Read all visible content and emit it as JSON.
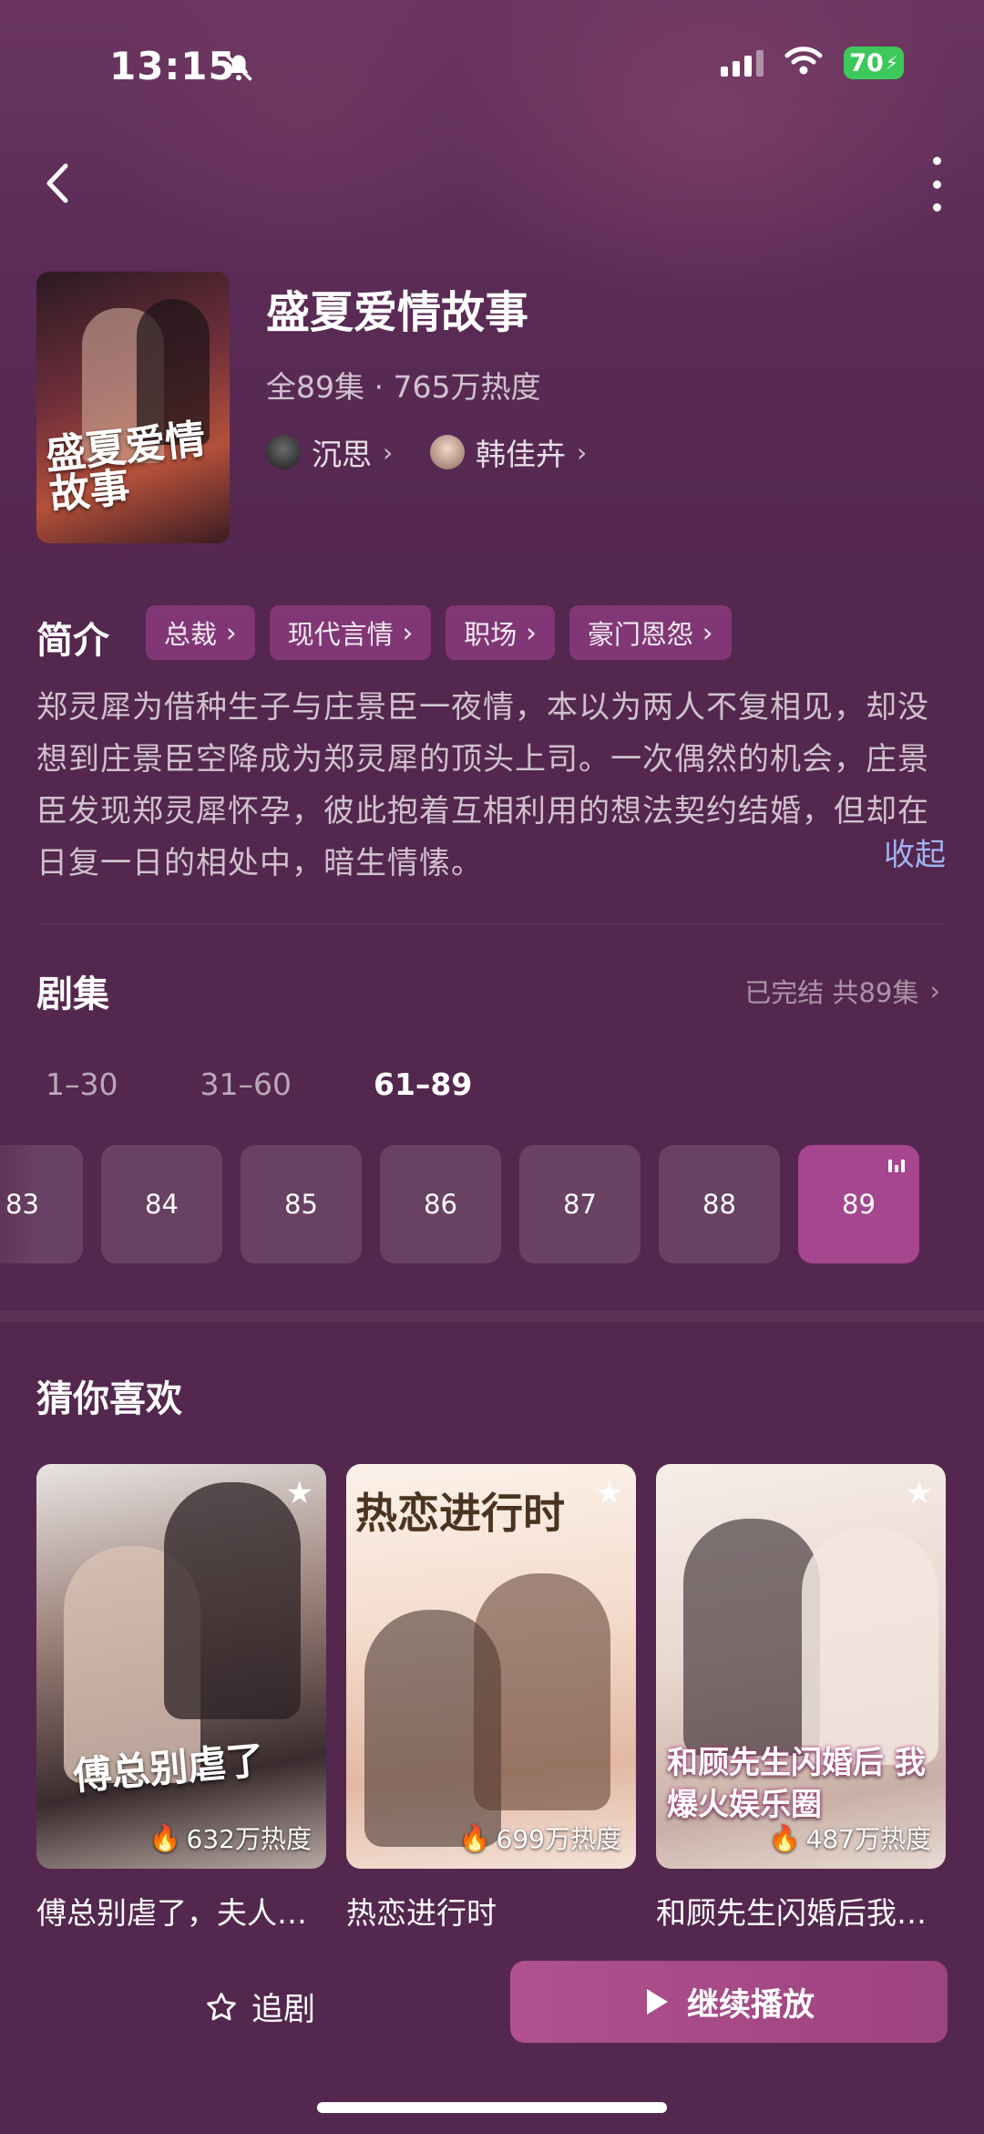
{
  "status_bar": {
    "time": "13:15",
    "battery": "70"
  },
  "drama": {
    "title": "盛夏爱情故事",
    "cover_title": "盛夏爱情故事",
    "meta": "全89集 · 765万热度",
    "cast": [
      {
        "name": "沉思"
      },
      {
        "name": "韩佳卉"
      }
    ]
  },
  "intro": {
    "label": "简介",
    "tags": [
      "总裁",
      "现代言情",
      "职场",
      "豪门恩怨"
    ],
    "description": "郑灵犀为借种生子与庄景臣一夜情，本以为两人不复相见，却没想到庄景臣空降成为郑灵犀的顶头上司。一次偶然的机会，庄景臣发现郑灵犀怀孕，彼此抱着互相利用的想法契约结婚，但却在日复一日的相处中，暗生情愫。",
    "collapse": "收起"
  },
  "episodes": {
    "label": "剧集",
    "status": "已完结 共89集",
    "ranges": [
      "1–30",
      "31–60",
      "61–89"
    ],
    "active_range": "61–89",
    "items": [
      "83",
      "84",
      "85",
      "86",
      "87",
      "88",
      "89"
    ],
    "current": "89"
  },
  "recommend": {
    "label": "猜你喜欢",
    "items": [
      {
        "name": "傅总别虐了，夫人…",
        "heat": "632万热度",
        "poster_text": "傅总别虐了"
      },
      {
        "name": "热恋进行时",
        "heat": "699万热度",
        "poster_text": "热恋进行时"
      },
      {
        "name": "和顾先生闪婚后我…",
        "heat": "487万热度",
        "poster_text": "和顾先生闪婚后 我爆火娱乐圈"
      }
    ]
  },
  "bottom_bar": {
    "follow": "追剧",
    "play": "继续播放"
  }
}
